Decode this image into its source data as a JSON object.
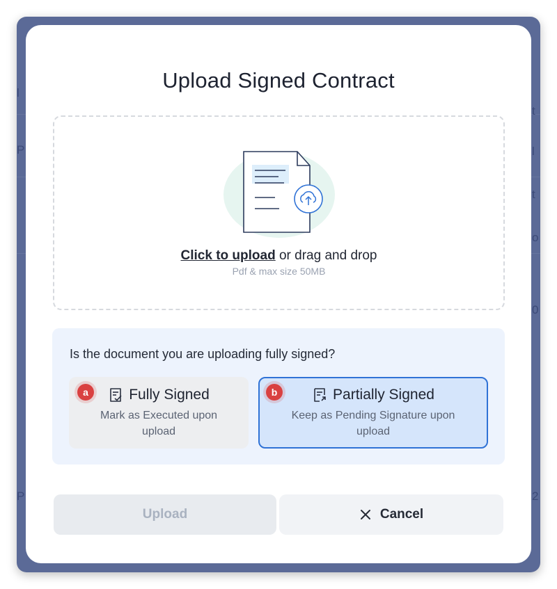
{
  "modal": {
    "title": "Upload Signed Contract"
  },
  "dropzone": {
    "link_text": "Click to upload",
    "rest_text": " or drag and drop",
    "hint": "Pdf & max size 50MB",
    "icons": [
      "document-icon",
      "cloud-upload-icon"
    ]
  },
  "signed_question": {
    "question": "Is the document you are uploading fully signed?",
    "options": [
      {
        "badge": "a",
        "icon": "document-check-icon",
        "label": "Fully Signed",
        "description": "Mark as Executed upon upload",
        "selected": false
      },
      {
        "badge": "b",
        "icon": "document-pending-icon",
        "label": "Partially Signed",
        "description": "Keep as Pending Signature upon upload",
        "selected": true
      }
    ]
  },
  "actions": {
    "upload_label": "Upload",
    "upload_disabled": true,
    "cancel_label": "Cancel",
    "cancel_icon": "close-icon"
  },
  "colors": {
    "backdrop": "#5b6a97",
    "accent": "#2f72d6",
    "selected_option_bg": "#d5e5fb",
    "panel_bg": "#edf3fd",
    "badge": "#d94141"
  }
}
